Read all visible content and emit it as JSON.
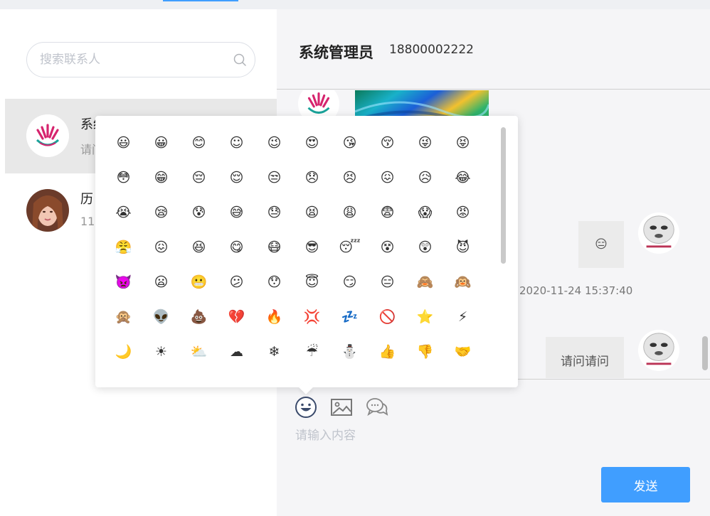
{
  "search": {
    "placeholder": "搜索联系人"
  },
  "contacts": [
    {
      "name": "系统管理员",
      "preview": "请问请问"
    },
    {
      "name": "历",
      "preview": "11"
    }
  ],
  "chat": {
    "title": "系统管理员",
    "phone": "18800002222",
    "timestamp": "2020-11-24 15:37:40",
    "sent_emoji": "😑",
    "sent_text": "请问请问"
  },
  "composer": {
    "placeholder": "请输入内容",
    "send_label": "发送",
    "tools": [
      "smiley-face-icon",
      "image-icon",
      "chat-bubbles-icon"
    ]
  },
  "emoji_picker": {
    "emojis": [
      "😃",
      "😀",
      "😊",
      "☺",
      "😉",
      "😍",
      "😘",
      "😚",
      "😜",
      "😝",
      "😳",
      "😁",
      "😔",
      "😌",
      "😒",
      "😞",
      "😣",
      "😖",
      "😥",
      "😂",
      "😭",
      "😪",
      "😰",
      "😅",
      "😓",
      "😫",
      "😩",
      "😨",
      "😱",
      "😡",
      "😤",
      "😖",
      "😆",
      "😋",
      "😷",
      "😎",
      "😴",
      "😵",
      "😲",
      "😈",
      "👿",
      "😦",
      "😬",
      "😕",
      "😯",
      "😇",
      "😏",
      "😑",
      "🙈",
      "🙉",
      "🙊",
      "👽",
      "💩",
      "💔",
      "🔥",
      "💢",
      "💤",
      "🚫",
      "⭐",
      "⚡",
      "🌙",
      "☀",
      "⛅",
      "☁",
      "❄",
      "☔",
      "⛄",
      "👍",
      "👎",
      "🤝"
    ]
  },
  "colors": {
    "accent": "#409eff",
    "active_contact": "#e8e8e8",
    "panel_bg": "#f5f5f7"
  }
}
